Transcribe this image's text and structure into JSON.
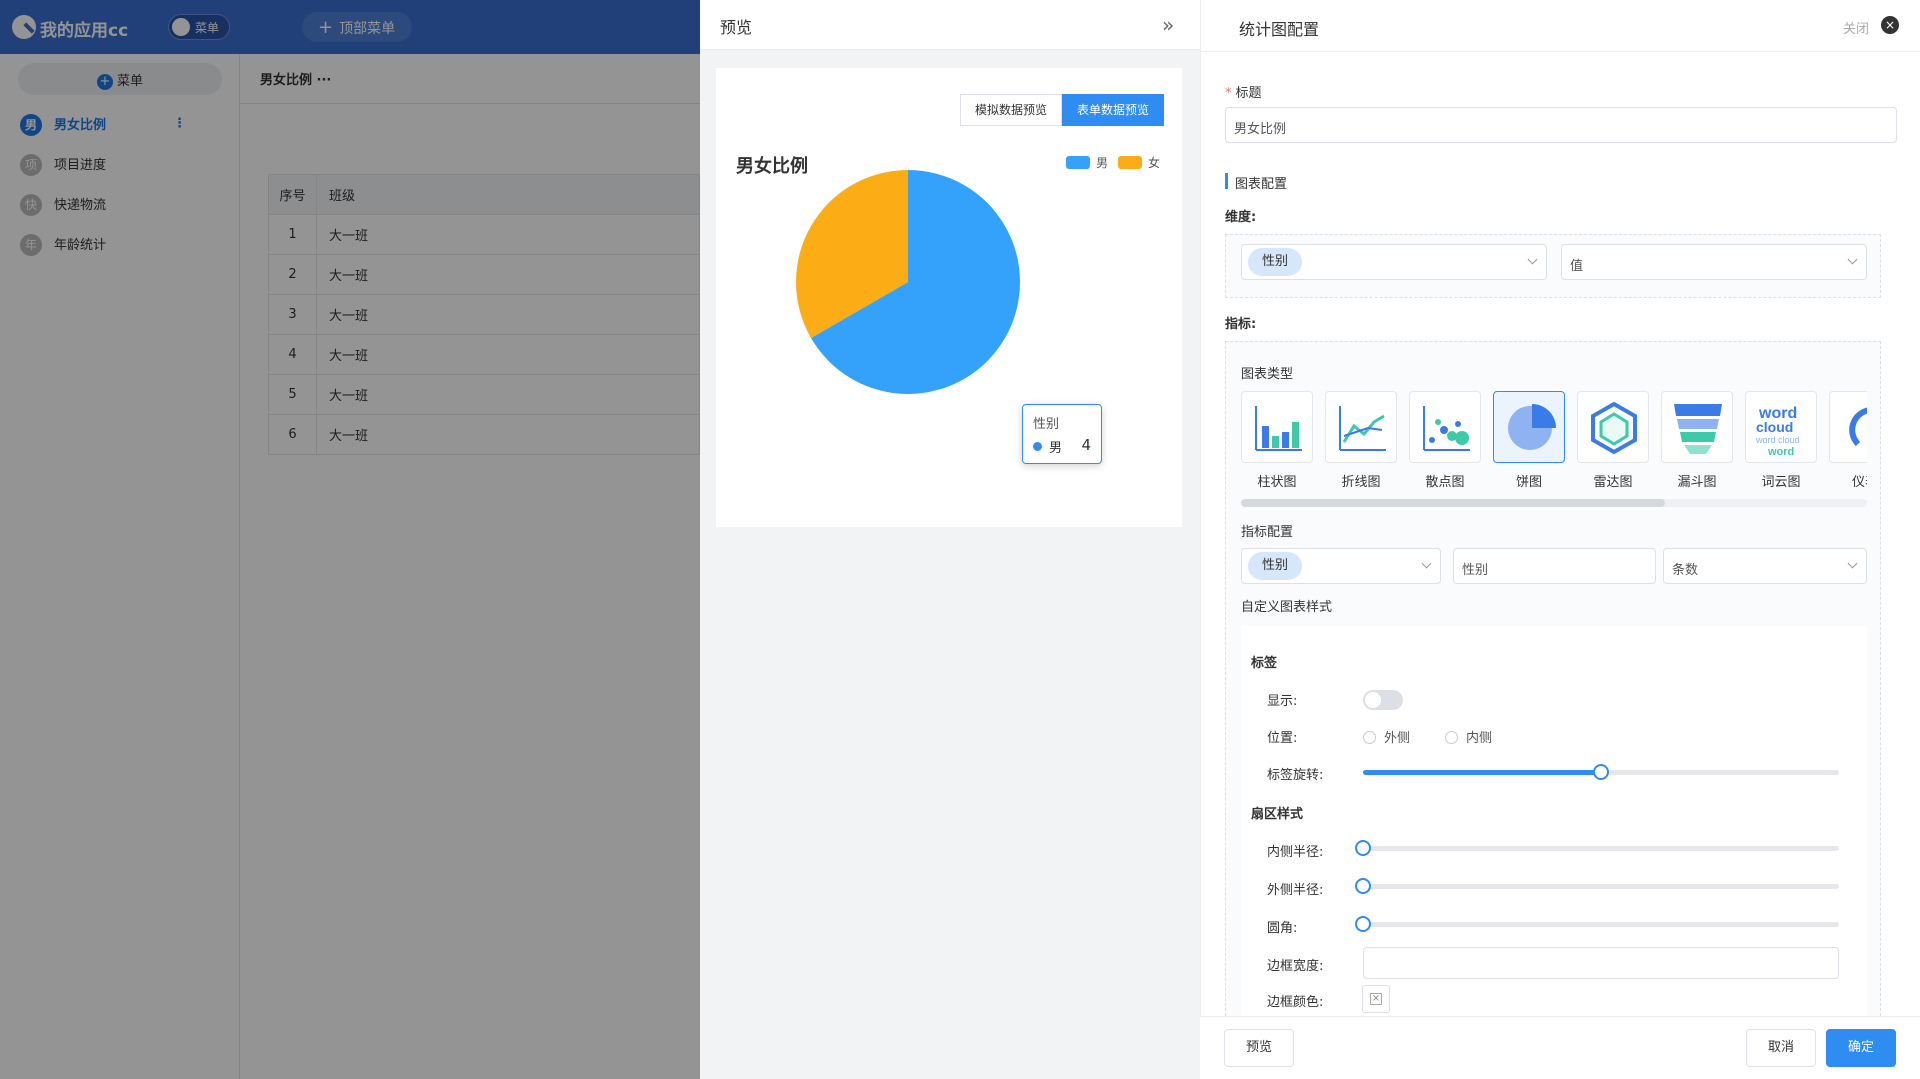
{
  "app": {
    "title": "我的应用cc",
    "menu_toggle": "菜单",
    "top_menu": "顶部菜单"
  },
  "sidebar": {
    "add_menu": "菜单",
    "items": [
      {
        "avatar": "男",
        "label": "男女比例",
        "active": true
      },
      {
        "avatar": "项",
        "label": "项目进度"
      },
      {
        "avatar": "快",
        "label": "快递物流"
      },
      {
        "avatar": "年",
        "label": "年龄统计"
      }
    ]
  },
  "content": {
    "tab_title": "男女比例",
    "tab_more": "···",
    "table": {
      "headers": [
        "序号",
        "班级"
      ],
      "rows": [
        [
          "1",
          "大一班"
        ],
        [
          "2",
          "大一班"
        ],
        [
          "3",
          "大一班"
        ],
        [
          "4",
          "大一班"
        ],
        [
          "5",
          "大一班"
        ],
        [
          "6",
          "大一班"
        ]
      ]
    }
  },
  "preview": {
    "title": "预览",
    "collapse_icon": "»",
    "mode_mock": "模拟数据预览",
    "mode_form": "表单数据预览",
    "tooltip": {
      "title": "性别",
      "name": "男",
      "value": "4"
    }
  },
  "chart_data": {
    "type": "pie",
    "title": "男女比例",
    "series": [
      {
        "name": "男",
        "value": 4,
        "color": "#34a1fa"
      },
      {
        "name": "女",
        "value": 2,
        "color": "#fcac15"
      }
    ],
    "legend_position": "top-right"
  },
  "config": {
    "title": "统计图配置",
    "close_label": "关闭",
    "close_icon": "×",
    "field_title_label": "标题",
    "field_title_value": "男女比例",
    "section_chart": "图表配置",
    "dimension_label": "维度:",
    "dimension_field": "性别",
    "dimension_value_placeholder": "值",
    "metric_label": "指标:",
    "chart_type_label": "图表类型",
    "chart_types": [
      {
        "name": "柱状图",
        "icon": "bar-chart-icon"
      },
      {
        "name": "折线图",
        "icon": "line-chart-icon"
      },
      {
        "name": "散点图",
        "icon": "scatter-chart-icon"
      },
      {
        "name": "饼图",
        "icon": "pie-chart-icon",
        "selected": true
      },
      {
        "name": "雷达图",
        "icon": "radar-chart-icon"
      },
      {
        "name": "漏斗图",
        "icon": "funnel-chart-icon"
      },
      {
        "name": "词云图",
        "icon": "word-cloud-icon",
        "icon_text": [
          "word",
          "cloud",
          "word cloud",
          "word"
        ]
      },
      {
        "name": "仪表",
        "icon": "gauge-chart-icon"
      }
    ],
    "metric_config_label": "指标配置",
    "metric_field": "性别",
    "metric_name": "性别",
    "metric_agg": "条数",
    "custom_style_label": "自定义图表样式",
    "label_section": "标签",
    "show_label": "显示:",
    "position_label": "位置:",
    "position_outside": "外侧",
    "position_inside": "内侧",
    "rotate_label": "标签旋转:",
    "rotate_value": 0.5,
    "sector_section": "扇区样式",
    "inner_radius_label": "内侧半径:",
    "inner_radius_value": 0,
    "outer_radius_label": "外侧半径:",
    "outer_radius_value": 0,
    "corner_label": "圆角:",
    "corner_value": 0,
    "border_width_label": "边框宽度:",
    "border_color_label": "边框颜色:"
  },
  "footer": {
    "preview": "预览",
    "cancel": "取消",
    "confirm": "确定"
  }
}
